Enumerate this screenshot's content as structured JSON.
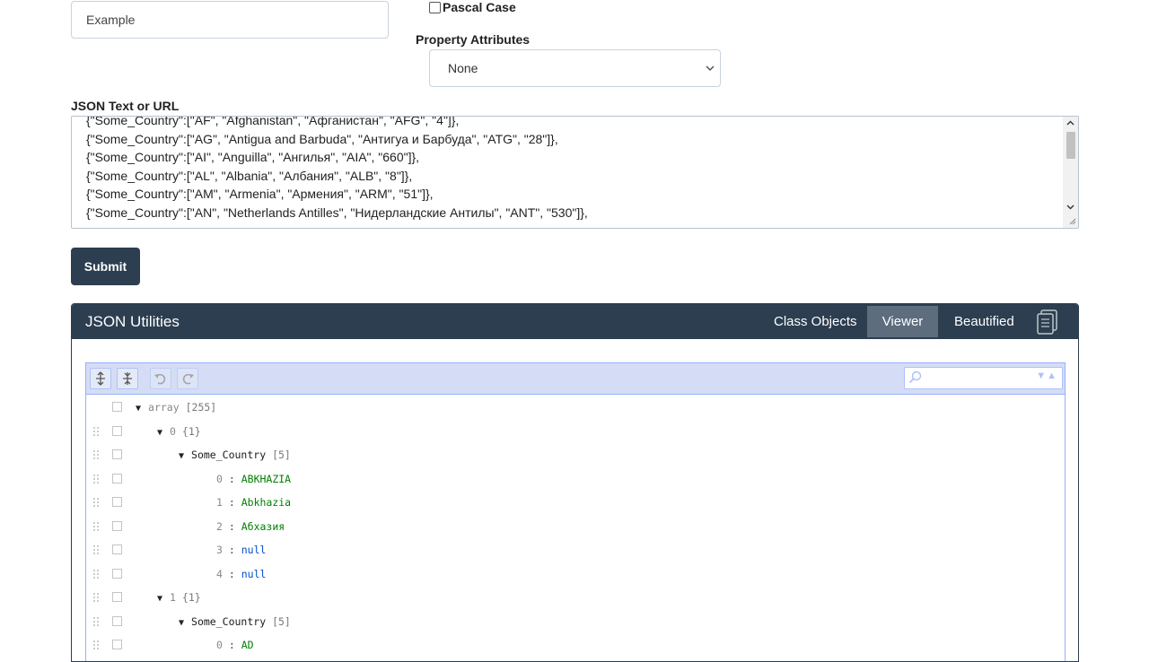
{
  "form": {
    "class_name_value": "Example",
    "pascal_case_label": "Pascal Case",
    "property_attributes_label": "Property Attributes",
    "property_attributes_value": "None",
    "json_label": "JSON Text or URL",
    "json_lines": [
      "{\"Some_Country\":[\"AF\", \"Afghanistan\", \"Афганистан\", \"AFG\", \"4\"]},",
      "{\"Some_Country\":[\"AG\", \"Antigua and Barbuda\", \"Антигуа и Барбуда\", \"ATG\", \"28\"]},",
      "{\"Some_Country\":[\"AI\", \"Anguilla\", \"Ангилья\", \"AIA\", \"660\"]},",
      "{\"Some_Country\":[\"AL\", \"Albania\", \"Албания\", \"ALB\", \"8\"]},",
      "{\"Some_Country\":[\"AM\", \"Armenia\", \"Армения\", \"ARM\", \"51\"]},",
      "{\"Some_Country\":[\"AN\", \"Netherlands Antilles\", \"Нидерландские Антилы\", \"ANT\", \"530\"]},"
    ],
    "submit_label": "Submit"
  },
  "panel": {
    "title": "JSON Utilities",
    "tabs": [
      {
        "label": "Class Objects",
        "active": false
      },
      {
        "label": "Viewer",
        "active": true
      },
      {
        "label": "Beautified",
        "active": false
      }
    ],
    "copy_icon": "copy-icon"
  },
  "editor": {
    "toolbar_icons": [
      "expand-all-icon",
      "collapse-all-icon",
      "undo-icon",
      "redo-icon"
    ],
    "search_placeholder": "",
    "tree": [
      {
        "type": "array",
        "key": "array",
        "count": "[255]"
      },
      {
        "type": "object",
        "key": "0",
        "count": "{1}"
      },
      {
        "type": "array",
        "key": "Some_Country",
        "count": "[5]"
      },
      {
        "type": "value",
        "key": "0",
        "value": "ABKHAZIA",
        "vtype": "string"
      },
      {
        "type": "value",
        "key": "1",
        "value": "Abkhazia",
        "vtype": "string"
      },
      {
        "type": "value",
        "key": "2",
        "value": "Абхазия",
        "vtype": "string"
      },
      {
        "type": "value",
        "key": "3",
        "value": "null",
        "vtype": "null"
      },
      {
        "type": "value",
        "key": "4",
        "value": "null",
        "vtype": "null"
      },
      {
        "type": "object",
        "key": "1",
        "count": "{1}"
      },
      {
        "type": "array",
        "key": "Some_Country",
        "count": "[5]"
      },
      {
        "type": "value",
        "key": "0",
        "value": "AD",
        "vtype": "string"
      }
    ]
  }
}
